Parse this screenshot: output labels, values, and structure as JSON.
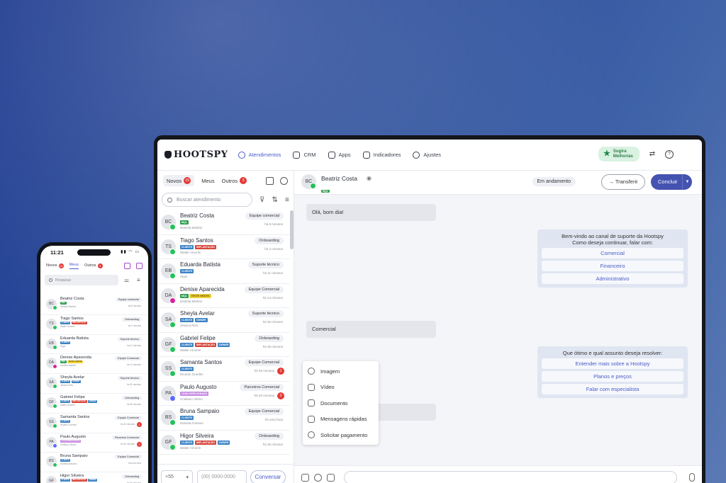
{
  "app": {
    "logo": "HOOTSPY"
  },
  "nav": [
    {
      "label": "Atendimentos",
      "active": true
    },
    {
      "label": "CRM"
    },
    {
      "label": "Apps"
    },
    {
      "label": "Indicadores"
    },
    {
      "label": "Ajustes"
    }
  ],
  "sugira": {
    "line1": "Sugira",
    "line2": "Melhorias"
  },
  "tabs": {
    "novos": "Novos",
    "novos_count": "15",
    "meus": "Meus",
    "outros": "Outros",
    "outros_count": "3"
  },
  "search": {
    "placeholder": "Buscar atendimento"
  },
  "colors": {
    "mql": "#2e9e4f",
    "cliente": "#3b82c4",
    "implantacao": "#d8453a",
    "teste": "#f2d23a",
    "owner": "#3b82c4",
    "lead": "#c58be0",
    "accent": "#4452b0"
  },
  "conversations": [
    {
      "initials": "BC",
      "name": "Beatriz Costa",
      "channel": "wa",
      "tags": [
        {
          "t": "MQL",
          "c": "mql"
        }
      ],
      "sub": "Daniela Martins",
      "team": "Equipe comercial",
      "time": "há 8 minutos",
      "count": ""
    },
    {
      "initials": "TS",
      "name": "Tiago Santos",
      "channel": "wa",
      "tags": [
        {
          "t": "CLIENTE",
          "c": "cliente"
        },
        {
          "t": "IMPLANTAÇÃO",
          "c": "implantacao"
        }
      ],
      "sub": "Walter Amorim",
      "team": "Onboarding",
      "time": "há 2 minutos",
      "count": ""
    },
    {
      "initials": "EB",
      "name": "Eduarda Batista",
      "channel": "wa",
      "tags": [
        {
          "t": "CLIENTE",
          "c": "cliente"
        }
      ],
      "sub": "Higor",
      "team": "Suporte técnico",
      "time": "há 11 minutos",
      "count": ""
    },
    {
      "initials": "DA",
      "name": "Denise Aparecida",
      "channel": "ig",
      "tags": [
        {
          "t": "MQL",
          "c": "mql"
        },
        {
          "t": "TESTE GRÁTIS",
          "c": "teste"
        }
      ],
      "sub": "Daniela Martins",
      "team": "Equipe Comercial",
      "time": "há 14 minutos",
      "count": ""
    },
    {
      "initials": "SA",
      "name": "Sheyla Avelar",
      "channel": "wa",
      "tags": [
        {
          "t": "CLIENTE",
          "c": "cliente"
        },
        {
          "t": "OWNER",
          "c": "owner"
        }
      ],
      "sub": "Jéssica Reis",
      "team": "Suporte técnico",
      "time": "há 30 minutos",
      "count": ""
    },
    {
      "initials": "GF",
      "name": "Gabriel Felipe",
      "channel": "wa",
      "tags": [
        {
          "t": "CLIENTE",
          "c": "cliente"
        },
        {
          "t": "IMPLANTAÇÃO",
          "c": "implantacao"
        },
        {
          "t": "OWNER",
          "c": "owner"
        }
      ],
      "sub": "Walter Amorim",
      "team": "Onboarding",
      "time": "há 35 minutos",
      "count": ""
    },
    {
      "initials": "SS",
      "name": "Samanta Santos",
      "channel": "wa",
      "tags": [
        {
          "t": "CLIENTE",
          "c": "cliente"
        }
      ],
      "sub": "Ricardo Guedes",
      "team": "Equipe Comercial",
      "time": "há 40 minutos",
      "count": "1"
    },
    {
      "initials": "PA",
      "name": "Paulo Augusto",
      "channel": "ms",
      "tags": [
        {
          "t": "LEAD DIRECIONADO",
          "c": "lead"
        }
      ],
      "sub": "Cristiano Vitório",
      "team": "Parceiros Comercial",
      "time": "há 40 minutos",
      "count": "3"
    },
    {
      "initials": "BS",
      "name": "Bruna Sampaio",
      "channel": "wa",
      "tags": [
        {
          "t": "CLIENTE",
          "c": "cliente"
        }
      ],
      "sub": "Daniela Antunes",
      "team": "Equipe Comercial",
      "time": "há uma hora",
      "count": ""
    },
    {
      "initials": "GF",
      "name": "Higor Silveira",
      "channel": "wa",
      "tags": [
        {
          "t": "CLIENTE",
          "c": "cliente"
        },
        {
          "t": "IMPLANTAÇÃO",
          "c": "implantacao"
        },
        {
          "t": "OWNER",
          "c": "owner"
        }
      ],
      "sub": "Walter Amorim",
      "team": "Onboarding",
      "time": "há 35 minutos",
      "count": ""
    }
  ],
  "footer": {
    "ddi": "+55",
    "phone_placeholder": "(00) 0000-0000",
    "conversar": "Conversar"
  },
  "chat": {
    "contact_initials": "BC",
    "contact_name": "Beatriz Costa",
    "contact_tag": "MQL",
    "status": "Em andamento",
    "transfer": "Transferir",
    "concluir": "Concluir",
    "msg1": "Olá, bom dia!",
    "bot1_title": "Bem-vindo ao canal de suporte da Hootspy",
    "bot1_sub": "Como deseja continuar, falar com:",
    "bot1_options": [
      "Comercial",
      "Financeiro",
      "Administrativo"
    ],
    "msg2": "Comercial",
    "bot2_title": "Que ótimo e qual assunto deseja resolver:",
    "bot2_options": [
      "Entender mais sobre a Hootspy",
      "Planos e preços",
      "Falar com especialista"
    ]
  },
  "attach_menu": [
    "Imagem",
    "Vídeo",
    "Documento",
    "Mensagens rápidas",
    "Solicitar pagamento"
  ],
  "phone": {
    "time": "11:21",
    "tabs": {
      "novos": "Novos",
      "novos_count": "15",
      "meus": "Meus",
      "outros": "Outros",
      "outros_count": "3"
    },
    "search_placeholder": "Pesquisar"
  }
}
